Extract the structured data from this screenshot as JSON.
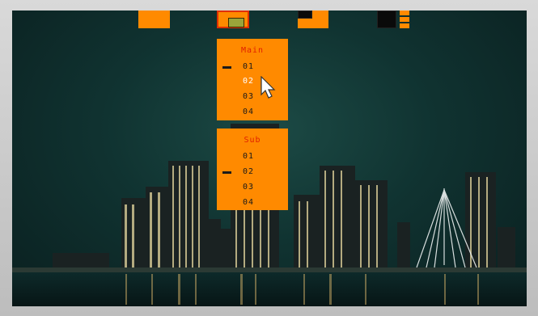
{
  "toolbar": {
    "buttons": [
      {
        "name": "layout-full-icon",
        "selected": false
      },
      {
        "name": "layout-pip-icon",
        "selected": true
      },
      {
        "name": "layout-split-icon",
        "selected": false
      },
      {
        "name": "layout-grid-icon",
        "selected": false
      }
    ],
    "accent": "#ff8a00",
    "selected_border": "#e03000"
  },
  "main_menu": {
    "title": "Main",
    "items": [
      "01",
      "02",
      "03",
      "04"
    ],
    "checked": "01",
    "hovered": "02"
  },
  "sub_menu": {
    "title": "Sub",
    "items": [
      "01",
      "02",
      "03",
      "04"
    ],
    "checked": "02"
  },
  "colors": {
    "menu_bg": "#ff8a00",
    "title": "#e02000",
    "item_text": "#1a1a1a",
    "hover_text": "#ffffff"
  }
}
